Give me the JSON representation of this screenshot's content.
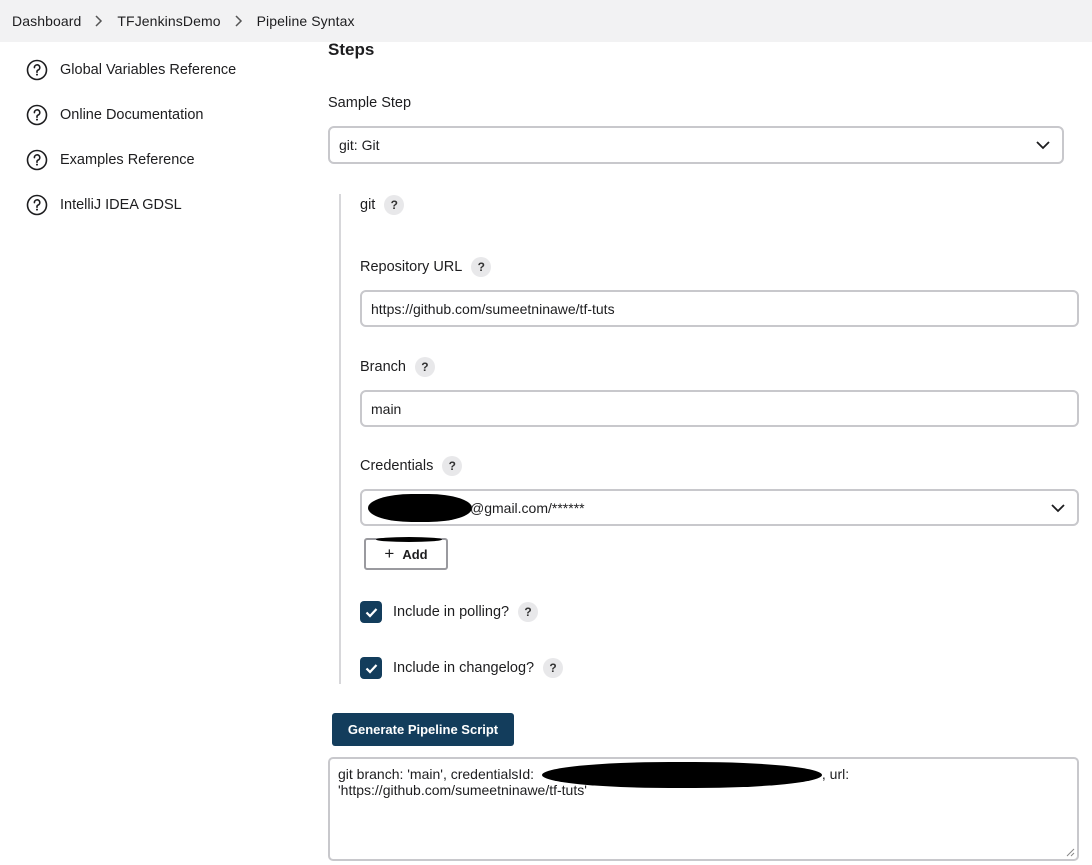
{
  "breadcrumb": {
    "items": [
      "Dashboard",
      "TFJenkinsDemo",
      "Pipeline Syntax"
    ]
  },
  "sidebar": {
    "items": [
      {
        "label": "Global Variables Reference",
        "icon": "help-circle-icon"
      },
      {
        "label": "Online Documentation",
        "icon": "help-circle-icon"
      },
      {
        "label": "Examples Reference",
        "icon": "help-circle-icon"
      },
      {
        "label": "IntelliJ IDEA GDSL",
        "icon": "help-circle-icon"
      }
    ]
  },
  "main": {
    "title": "Steps",
    "sample_step_label": "Sample Step",
    "sample_step_value": "git: Git",
    "step_name": "git",
    "help_glyph": "?",
    "repository_url_label": "Repository URL",
    "repository_url_value": "https://github.com/sumeetninawe/tf-tuts",
    "branch_label": "Branch",
    "branch_value": "main",
    "credentials_label": "Credentials",
    "credentials_value": "@gmail.com/******",
    "add_button_label": "Add",
    "include_polling_label": "Include in polling?",
    "include_polling_checked": true,
    "include_changelog_label": "Include in changelog?",
    "include_changelog_checked": true,
    "generate_button_label": "Generate Pipeline Script",
    "script_part1": "git branch: 'main', credentialsId: ",
    "script_part2": ", url:",
    "script_line2": "'https://github.com/sumeetninawe/tf-tuts'"
  },
  "colors": {
    "accent": "#133d5c",
    "breadcrumb_bg": "#f2f2f3",
    "border": "#c8c8cc"
  }
}
